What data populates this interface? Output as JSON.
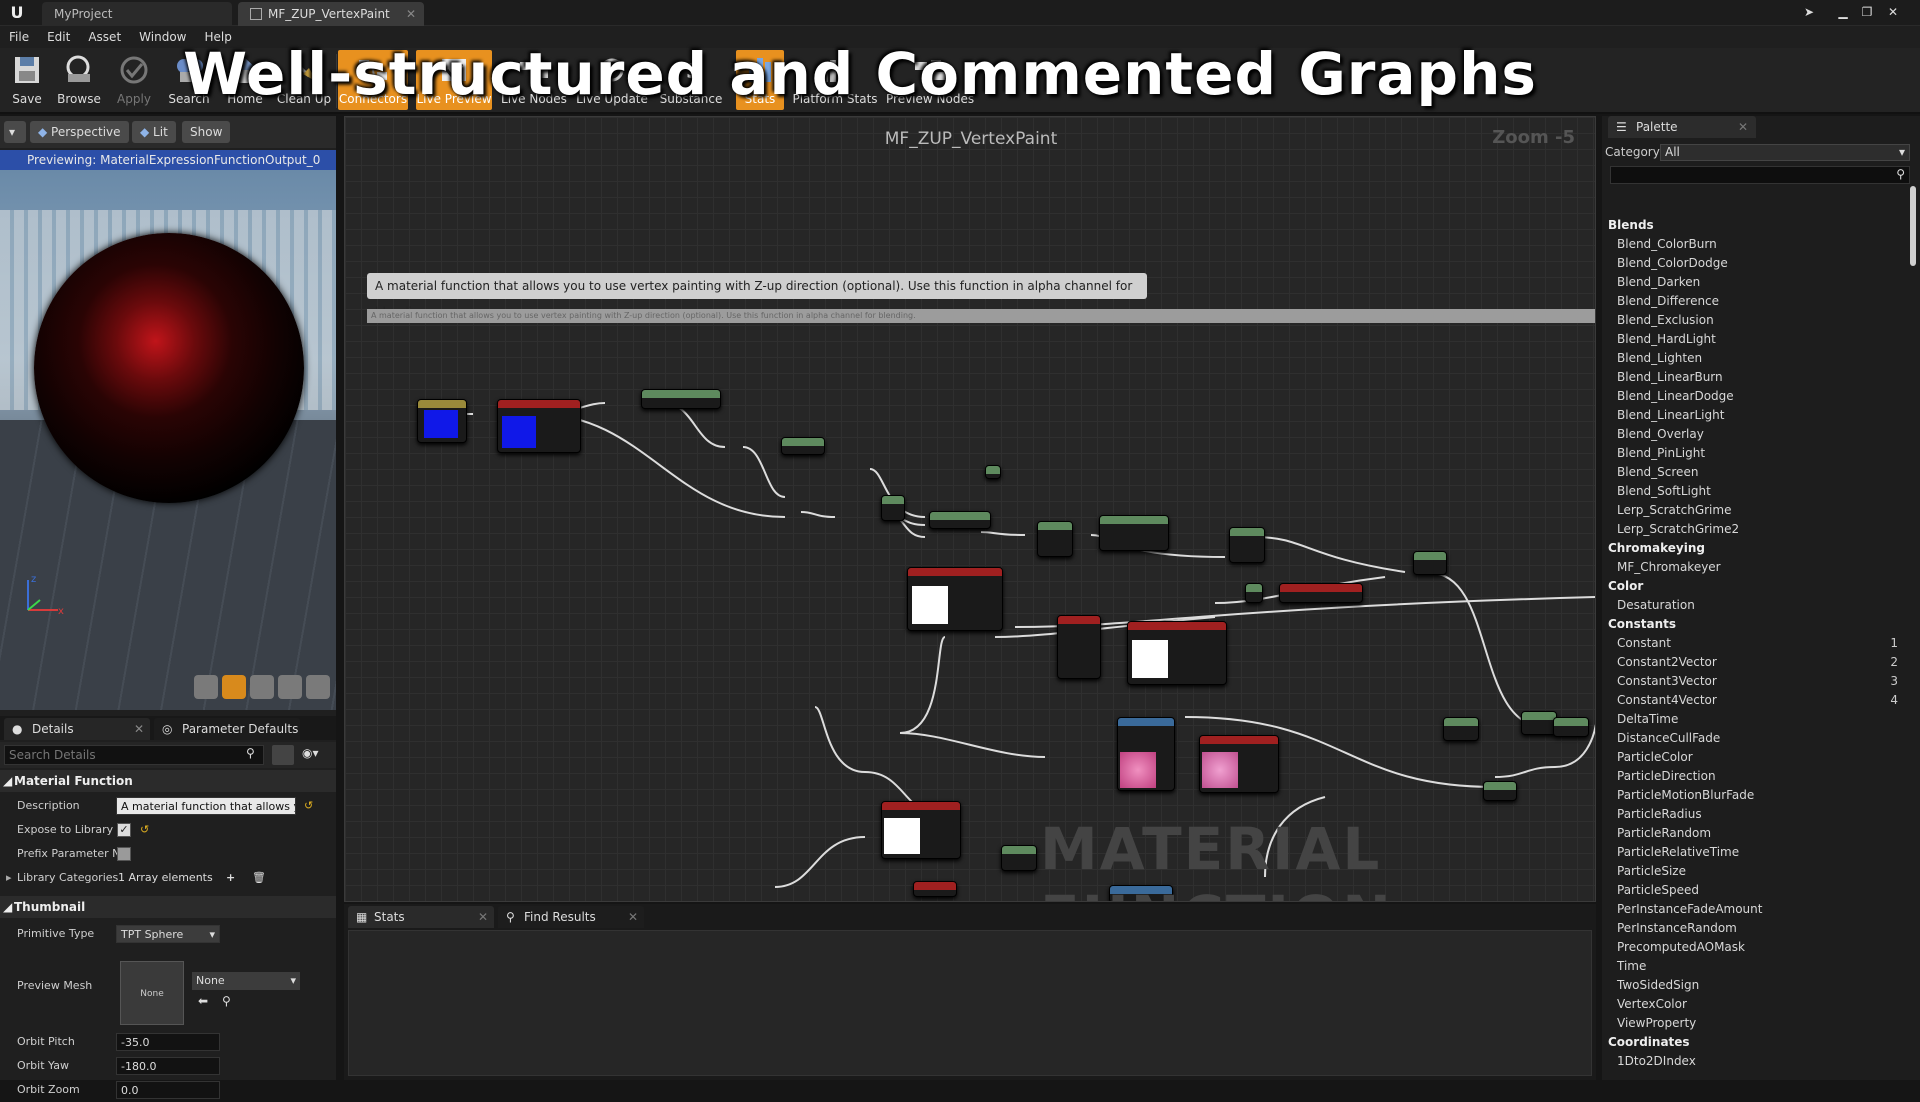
{
  "window": {
    "tabs": [
      {
        "label": "MyProject"
      },
      {
        "label": "MF_ZUP_VertexPaint"
      }
    ]
  },
  "menu": [
    "File",
    "Edit",
    "Asset",
    "Window",
    "Help"
  ],
  "toolbar": [
    {
      "label": "Save",
      "icon": "save-icon",
      "active": false
    },
    {
      "label": "Browse",
      "icon": "browse-icon",
      "active": false
    },
    {
      "label": "Apply",
      "icon": "apply-icon",
      "active": false,
      "disabled": true
    },
    {
      "label": "Search",
      "icon": "search-icon",
      "active": false
    },
    {
      "label": "Home",
      "icon": "home-icon",
      "active": false
    },
    {
      "label": "Clean Up",
      "icon": "cleanup-icon",
      "active": false
    },
    {
      "label": "Connectors",
      "icon": "connectors-icon",
      "active": true
    },
    {
      "label": "Live Preview",
      "icon": "live-preview-icon",
      "active": true
    },
    {
      "label": "Live Nodes",
      "icon": "live-nodes-icon",
      "active": false
    },
    {
      "label": "Live Update",
      "icon": "live-update-icon",
      "active": false
    },
    {
      "label": "Substance",
      "icon": "substance-icon",
      "active": false
    },
    {
      "label": "Stats",
      "icon": "stats-icon",
      "active": true
    },
    {
      "label": "Platform Stats",
      "icon": "platform-stats-icon",
      "active": false
    },
    {
      "label": "Preview Nodes",
      "icon": "preview-nodes-icon",
      "active": false
    }
  ],
  "viewport": {
    "buttons": {
      "perspective": "Perspective",
      "lit": "Lit",
      "show": "Show"
    },
    "preview_label": "Previewing: MaterialExpressionFunctionOutput_0"
  },
  "details": {
    "tabs": {
      "details": "Details",
      "param_defaults": "Parameter Defaults"
    },
    "search_placeholder": "Search Details",
    "material_function": {
      "header": "Material Function",
      "description_label": "Description",
      "description_value": "A material function that allows you",
      "expose_label": "Expose to Library",
      "prefix_label": "Prefix Parameter N",
      "library_label": "Library Categories",
      "library_value": "1 Array elements"
    },
    "thumbnail": {
      "header": "Thumbnail",
      "primitive_label": "Primitive Type",
      "primitive_value": "TPT Sphere",
      "mesh_label": "Preview Mesh",
      "mesh_thumb": "None",
      "mesh_value": "None",
      "pitch_label": "Orbit Pitch",
      "pitch_value": "-35.0",
      "yaw_label": "Orbit Yaw",
      "yaw_value": "-180.0",
      "zoom_label": "Orbit Zoom",
      "zoom_value": "0.0"
    }
  },
  "graph": {
    "title": "MF_ZUP_VertexPaint",
    "zoom": "Zoom -5",
    "banner": "Well-structured and Commented Graphs",
    "comment": "A material function that allows you to use vertex painting with Z-up direction (optional). Use this function in alpha channel for blending.",
    "comment_bar": "A material function that allows you to use vertex painting with Z-up direction (optional). Use this function in alpha channel for blending.",
    "watermark": "MATERIAL FUNCTION"
  },
  "palette": {
    "tab": "Palette",
    "category_label": "Category:",
    "category_value": "All",
    "groups": [
      {
        "name": "Blends",
        "items": [
          "Blend_ColorBurn",
          "Blend_ColorDodge",
          "Blend_Darken",
          "Blend_Difference",
          "Blend_Exclusion",
          "Blend_HardLight",
          "Blend_Lighten",
          "Blend_LinearBurn",
          "Blend_LinearDodge",
          "Blend_LinearLight",
          "Blend_Overlay",
          "Blend_PinLight",
          "Blend_Screen",
          "Blend_SoftLight",
          "Lerp_ScratchGrime",
          "Lerp_ScratchGrime2"
        ]
      },
      {
        "name": "Chromakeying",
        "items": [
          "MF_Chromakeyer"
        ]
      },
      {
        "name": "Color",
        "items": [
          "Desaturation"
        ]
      },
      {
        "name": "Constants",
        "items": [
          "Constant",
          "Constant2Vector",
          "Constant3Vector",
          "Constant4Vector",
          "DeltaTime",
          "DistanceCullFade",
          "ParticleColor",
          "ParticleDirection",
          "ParticleMotionBlurFade",
          "ParticleRadius",
          "ParticleRandom",
          "ParticleRelativeTime",
          "ParticleSize",
          "ParticleSpeed",
          "PerInstanceFadeAmount",
          "PerInstanceRandom",
          "PrecomputedAOMask",
          "Time",
          "TwoSidedSign",
          "VertexColor",
          "ViewProperty"
        ]
      },
      {
        "name": "Coordinates",
        "items": [
          "1Dto2DIndex"
        ]
      }
    ],
    "keys": {
      "Constant": "1",
      "Constant2Vector": "2",
      "Constant3Vector": "3",
      "Constant4Vector": "4"
    }
  },
  "bottom": {
    "tabs": [
      "Stats",
      "Find Results"
    ]
  }
}
